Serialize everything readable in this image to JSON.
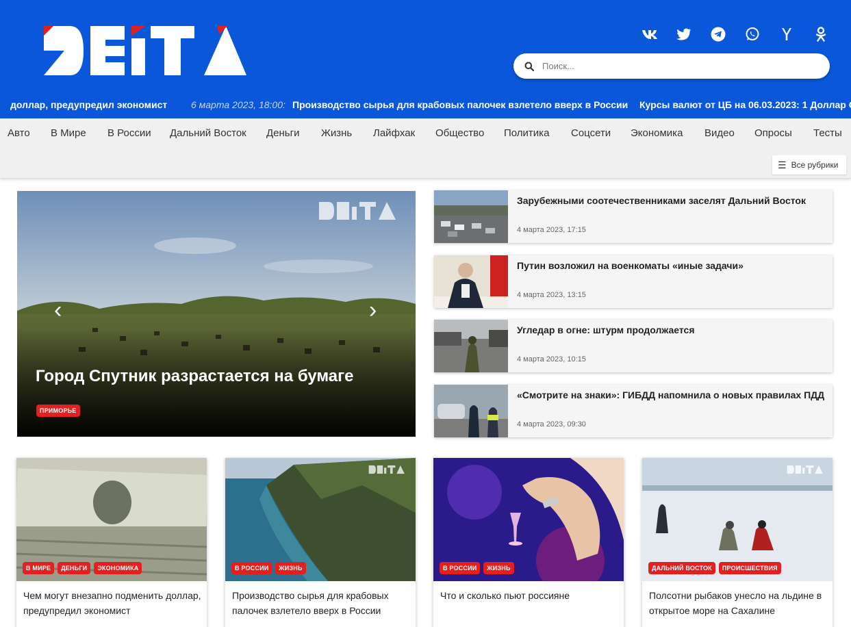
{
  "header": {
    "logo_text": "DEITA",
    "social": [
      "vk-icon",
      "twitter-icon",
      "telegram-icon",
      "whatsapp-icon",
      "yandex-icon",
      "odnoklassniki-icon"
    ],
    "search_placeholder": "Поиск..."
  },
  "ticker": {
    "items": [
      {
        "date": "",
        "text": "доллар, предупредил экономист"
      },
      {
        "date": "6 марта 2023, 18:00:",
        "text": "Производство сырья для крабовых палочек взлетело вверх в России"
      },
      {
        "date": "",
        "text": "Курсы валют от ЦБ на 06.03.2023: 1 Доллар С"
      }
    ]
  },
  "nav": {
    "items": [
      "Авто",
      "В Мире",
      "В России",
      "Дальний Восток",
      "Деньги",
      "Жизнь",
      "Лайфхак",
      "Общество",
      "Политика",
      "Соцсети",
      "Экономика",
      "Видео",
      "Опросы",
      "Тесты"
    ],
    "all_rubrics": "Все рубрики"
  },
  "hero": {
    "title": "Город Спутник разрастается на бумаге",
    "badge": "ПРИМОРЬЕ",
    "prev": "‹",
    "next": "›"
  },
  "side_news": [
    {
      "title": "Зарубежными соотечественниками заселят Дальний Восток",
      "date": "4 марта 2023, 17:15"
    },
    {
      "title": "Путин возложил на военкоматы «иные задачи»",
      "date": "4 марта 2023, 13:15"
    },
    {
      "title": "Угледар в огне: штурм продолжается",
      "date": "4 марта 2023, 10:15"
    },
    {
      "title": "«Смотрите на знаки»: ГИБДД напомнила о новых правилах ПДД",
      "date": "4 марта 2023, 09:30"
    }
  ],
  "cards": [
    {
      "title": "Чем могут внезапно подменить доллар, предупредил экономист",
      "badges": [
        "В МИРЕ",
        "ДЕНЬГИ",
        "ЭКОНОМИКА"
      ]
    },
    {
      "title": "Производство сырья для крабовых палочек взлетело вверх в России",
      "badges": [
        "В РОССИИ",
        "ЖИЗНЬ"
      ]
    },
    {
      "title": "Что и сколько пьют россияне",
      "badges": [
        "В РОССИИ",
        "ЖИЗНЬ"
      ]
    },
    {
      "title": "Полсотни рыбаков унесло на льдине в открытое море на Сахалине",
      "badges": [
        "ДАЛЬНИЙ ВОСТОК",
        "ПРОИСШЕСТВИЯ"
      ]
    }
  ],
  "colors": {
    "brand_blue": "#0a57da",
    "badge_red": "#e1201f"
  }
}
